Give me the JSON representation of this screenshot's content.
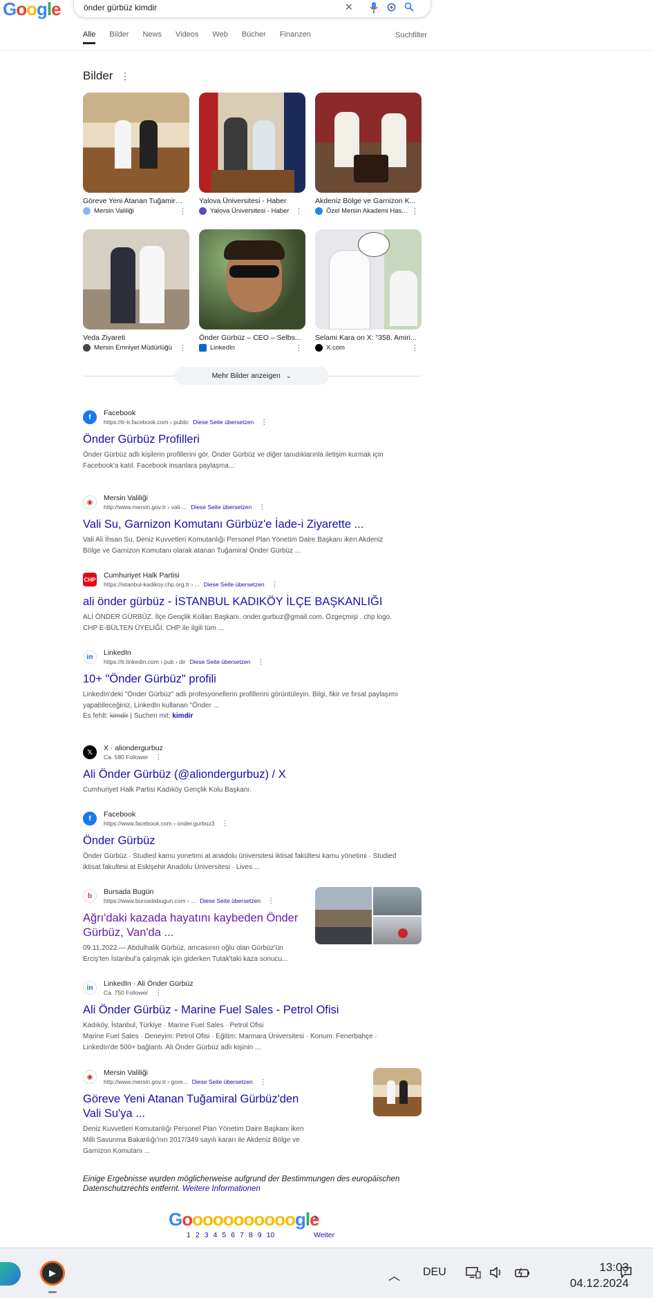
{
  "header": {
    "logo": "Google",
    "query": "önder gürbüz kimdir",
    "tabs": [
      "Alle",
      "Bilder",
      "News",
      "Videos",
      "Web",
      "Bücher",
      "Finanzen"
    ],
    "filter": "Suchfilter"
  },
  "images": {
    "title": "Bilder",
    "cards": [
      {
        "caption": "Göreve Yeni Atanan Tuğamiral ...",
        "source": "Mersin Valiliği"
      },
      {
        "caption": "Yalova Üniversitesi - Haber",
        "source": "Yalova Üniversitesi - Haber"
      },
      {
        "caption": "Akdeniz Bölge ve Garnizon K...",
        "source": "Özel Mersin Akademi Has..."
      },
      {
        "caption": "Veda Ziyareti",
        "source": "Mersin Emniyet Müdürlüğü"
      },
      {
        "caption": "Önder Gürbüz – CEO – Selbs...",
        "source": "LinkedIn"
      },
      {
        "caption": "Selami Kara on X: \"358. Amiri...",
        "source": "X.com"
      }
    ],
    "more_label": "Mehr Bilder anzeigen"
  },
  "results": [
    {
      "site": "Facebook",
      "url": "https://tr-tr.facebook.com › public",
      "translate": "Diese Seite übersetzen",
      "title": "Önder Gürbüz Profilleri",
      "snippet": "Önder Gürbüz adlı kişilerin profillerini gör. Önder Gürbüz ve diğer tanıdıklarınla iletişim kurmak için Facebook'a katıl. Facebook insanlara paylaşma..."
    },
    {
      "site": "Mersin Valiliği",
      "url": "http://www.mersin.gov.tr › vali-...",
      "translate": "Diese Seite übersetzen",
      "title": "Vali Su, Garnizon Komutanı Gürbüz'e İade-i Ziyarette ...",
      "snippet": "Vali Ali İhsan Su, Deniz Kuvvetleri Komutanlığı Personel Plan Yönetim Daire Başkanı iken Akdeniz Bölge ve Garnizon Komutanı olarak atanan Tuğamiral Önder Gürbüz ..."
    },
    {
      "site": "Cumhuriyet Halk Partisi",
      "url": "https://istanbul-kadikoy.chp.org.tr › ...",
      "translate": "Diese Seite übersetzen",
      "title": "ali önder gürbüz - İSTANBUL KADIKÖY İLÇE BAŞKANLIĞI",
      "snippet": "ALİ ÖNDER GÜRBÜZ. İlçe Gençlik Kolları Başkanı. onder.gurbuz@gmail.com. Özgeçmişi . chp logo. CHP E-BÜLTEN ÜYELİĞİ. CHP ile ilgili tüm ..."
    },
    {
      "site": "LinkedIn",
      "url": "https://tr.linkedin.com › pub › dir",
      "translate": "Diese Seite übersetzen",
      "title": "10+ \"Önder Gürbüz\" profili",
      "snippet": "LinkedIn'deki \"Önder Gürbüz\" adlı profesyonellerin profillerini görüntüleyin. Bilgi, fikir ve fırsat paylaşımı yapabileceğiniz, LinkedIn kullanan \"Önder ...",
      "missing_label": "Es fehlt:",
      "missing_word": "kimdir",
      "must_label": "| Suchen mit:",
      "must_word": "kimdir"
    },
    {
      "site": "X · aliondergurbuz",
      "url": "Ca. 580 Follower",
      "translate": "",
      "title": "Ali Önder Gürbüz (@aliondergurbuz) / X",
      "snippet": "Cumhuriyet Halk Partisi Kadıköy Gençlik Kolu Başkanı."
    },
    {
      "site": "Facebook",
      "url": "https://www.facebook.com › onder.gurbuz3",
      "translate": "",
      "title": "Önder Gürbüz",
      "snippet": "Önder Gürbüz · Studied kamu yonetimi at anadolu üniversitesi iktisat fakültesi kamu yönetimi · Studied iktisat fakultesi at Eskişehir Anadolu Üniversitesi · Lives ..."
    },
    {
      "site": "Bursada Bugün",
      "url": "https://www.bursadabugun.com › ...",
      "translate": "Diese Seite übersetzen",
      "title": "Ağrı'daki kazada hayatını kaybeden Önder Gürbüz, Van'da ...",
      "snippet": "09.11.2022 — Abdulhalik Gürbüz, amcasının oğlu olan Gürbüz'ün Erciş'ten İstanbul'a çalışmak için giderken Tutak'taki kaza sonucu..."
    },
    {
      "site": "LinkedIn · Ali Önder Gürbüz",
      "url": "Ca. 750 Follower",
      "translate": "",
      "title": "Ali Önder Gürbüz - Marine Fuel Sales - Petrol Ofisi",
      "snippet": "Kadıköy, İstanbul, Türkiye · Marine Fuel Sales · Petrol Ofisi",
      "snippet2": "Marine Fuel Sales · Deneyim: Petrol Ofisi · Eğitim: Marmara Üniversitesi · Konum: Fenerbahçe · LinkedIn'de 500+ bağlantı. Ali Önder Gürbüz adlı kişinin ..."
    },
    {
      "site": "Mersin Valiliği",
      "url": "http://www.mersin.gov.tr › gore...",
      "translate": "Diese Seite übersetzen",
      "title": "Göreve Yeni Atanan Tuğamiral Gürbüz'den Vali Su'ya ...",
      "snippet": "Deniz Kuvvetleri Komutanlığı Personel Plan Yönetim Daire Başkanı iken Milli Savunma Bakanlığı'nın 2017/349 sayılı kararı ile Akdeniz Bölge ve Garnizon Komutanı ..."
    }
  ],
  "footer": {
    "note": "Einige Ergebnisse wurden möglicherweise aufgrund der Bestimmungen des europäischen Datenschutzrechts entfernt.",
    "more_info": "Weitere Informationen"
  },
  "pager": {
    "logo": "Gooooooooooogle",
    "current": "1",
    "pages": [
      "2",
      "3",
      "4",
      "5",
      "6",
      "7",
      "8",
      "9",
      "10"
    ],
    "next": "Weiter"
  },
  "taskbar": {
    "language": "DEU",
    "time": "13:03",
    "date": "04.12.2024"
  },
  "colors": {
    "link": "#1a0dab",
    "visited": "#681da8",
    "snippet": "#4d5156"
  }
}
